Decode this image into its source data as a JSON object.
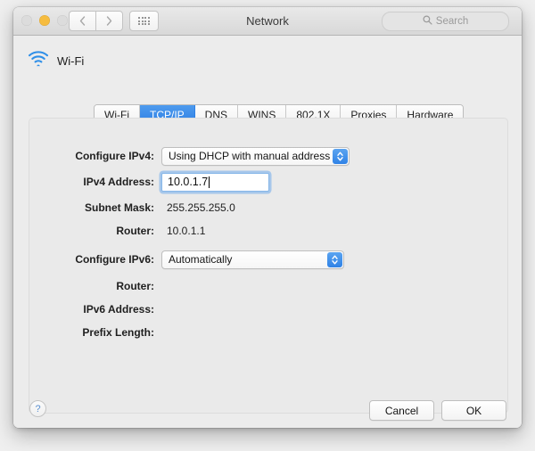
{
  "window": {
    "title": "Network",
    "traffic_lights": [
      "close-button",
      "minimize-button",
      "zoom-button"
    ],
    "search": {
      "placeholder": "Search"
    },
    "nav": {
      "back_label": "Back",
      "forward_label": "Forward",
      "showall_label": "Show All"
    }
  },
  "service": {
    "icon": "wifi-icon",
    "name": "Wi-Fi"
  },
  "tabs": [
    {
      "label": "Wi-Fi",
      "selected": false
    },
    {
      "label": "TCP/IP",
      "selected": true
    },
    {
      "label": "DNS",
      "selected": false
    },
    {
      "label": "WINS",
      "selected": false
    },
    {
      "label": "802.1X",
      "selected": false
    },
    {
      "label": "Proxies",
      "selected": false
    },
    {
      "label": "Hardware",
      "selected": false
    }
  ],
  "ipv4": {
    "configure_label": "Configure IPv4:",
    "configure_value": "Using DHCP with manual address",
    "address_label": "IPv4 Address:",
    "address_value": "10.0.1.7",
    "subnet_label": "Subnet Mask:",
    "subnet_value": "255.255.255.0",
    "router_label": "Router:",
    "router_value": "10.0.1.1"
  },
  "ipv6": {
    "configure_label": "Configure IPv6:",
    "configure_value": "Automatically",
    "router_label": "Router:",
    "router_value": "",
    "address_label": "IPv6 Address:",
    "address_value": "",
    "prefix_label": "Prefix Length:",
    "prefix_value": ""
  },
  "footer": {
    "help_label": "?",
    "cancel_label": "Cancel",
    "ok_label": "OK"
  },
  "colors": {
    "accent_blue": "#2f80e4",
    "wifi_blue": "#2f8fe8",
    "window_bg": "#ececec",
    "panel_bg": "#eaeaea"
  }
}
